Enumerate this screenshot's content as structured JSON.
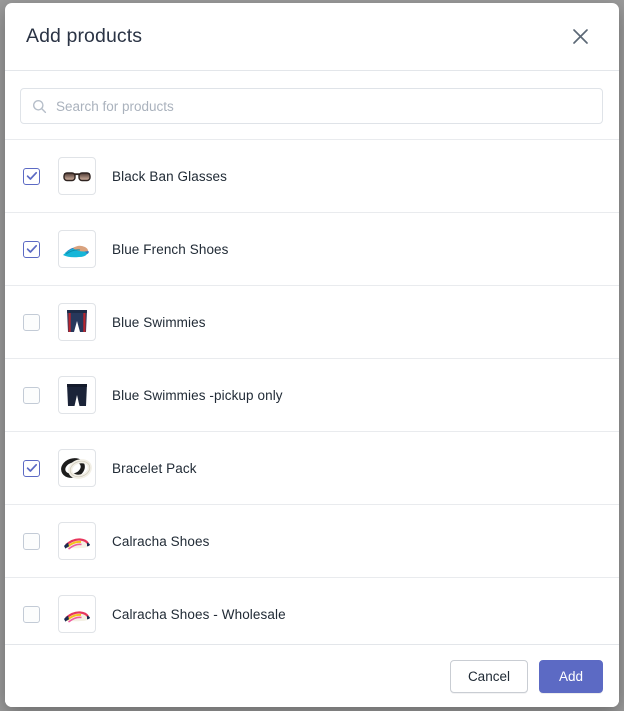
{
  "modal": {
    "title": "Add products",
    "close_icon": "close-icon"
  },
  "search": {
    "placeholder": "Search for products",
    "value": "",
    "icon": "search-icon"
  },
  "products": [
    {
      "label": "Black Ban Glasses",
      "checked": true,
      "thumb": "sunglasses"
    },
    {
      "label": "Blue French Shoes",
      "checked": true,
      "thumb": "blue-flats"
    },
    {
      "label": "Blue Swimmies",
      "checked": false,
      "thumb": "striped-shorts"
    },
    {
      "label": "Blue Swimmies -pickup only",
      "checked": false,
      "thumb": "navy-shorts"
    },
    {
      "label": "Bracelet Pack",
      "checked": true,
      "thumb": "bangles"
    },
    {
      "label": "Calracha Shoes",
      "checked": false,
      "thumb": "color-flats"
    },
    {
      "label": "Calracha Shoes - Wholesale",
      "checked": false,
      "thumb": "color-flats"
    }
  ],
  "footer": {
    "cancel_label": "Cancel",
    "add_label": "Add"
  },
  "colors": {
    "accent": "#5c6ac4",
    "text": "#212b36",
    "title": "#2b3445",
    "placeholder": "#aab2bd",
    "border": "#e3e6ea",
    "backdrop": "#9b9b9b"
  }
}
